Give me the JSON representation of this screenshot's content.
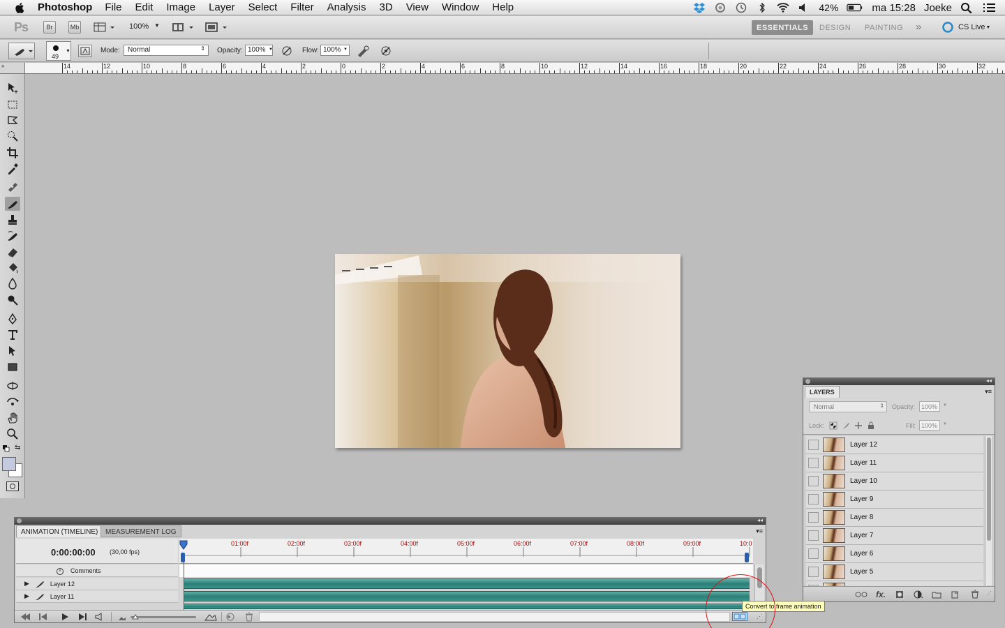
{
  "menubar": {
    "app": "Photoshop",
    "items": [
      "File",
      "Edit",
      "Image",
      "Layer",
      "Select",
      "Filter",
      "Analysis",
      "3D",
      "View",
      "Window",
      "Help"
    ],
    "battery": "42%",
    "clock": "ma 15:28",
    "user": "Joeke"
  },
  "appbar": {
    "logo": "Ps",
    "br": "Br",
    "mb": "Mb",
    "zoom": "100%",
    "workspaces": [
      "ESSENTIALS",
      "DESIGN",
      "PAINTING"
    ],
    "cslive": "CS Live"
  },
  "options": {
    "brush_size": "49",
    "mode_label": "Mode:",
    "mode_value": "Normal",
    "opacity_label": "Opacity:",
    "opacity_value": "100%",
    "flow_label": "Flow:",
    "flow_value": "100%"
  },
  "ruler": {
    "labels": [
      "14",
      "12",
      "10",
      "8",
      "6",
      "4",
      "2",
      "0",
      "2",
      "4",
      "6",
      "8",
      "10",
      "12",
      "14",
      "16",
      "18",
      "20",
      "22",
      "24",
      "26",
      "28",
      "30",
      "32"
    ]
  },
  "animation": {
    "tabs": [
      "ANIMATION (TIMELINE)",
      "MEASUREMENT LOG"
    ],
    "timecode": "0:00:00:00",
    "fps": "(30,00 fps)",
    "time_labels": [
      "01:00f",
      "02:00f",
      "03:00f",
      "04:00f",
      "05:00f",
      "06:00f",
      "07:00f",
      "08:00f",
      "09:00f",
      "10:0"
    ],
    "rows": [
      "Comments",
      "Layer 12",
      "Layer 11"
    ],
    "tooltip": "Convert to frame animation"
  },
  "layers": {
    "title": "LAYERS",
    "blend": "Normal",
    "opacity_label": "Opacity:",
    "opacity_value": "100%",
    "lock_label": "Lock:",
    "fill_label": "Fill:",
    "fill_value": "100%",
    "items": [
      "Layer 12",
      "Layer 11",
      "Layer 10",
      "Layer 9",
      "Layer 8",
      "Layer 7",
      "Layer 6",
      "Layer 5"
    ],
    "footer_fx": "fx."
  },
  "colors": {
    "timeline_bar": "#3a958c",
    "time_label": "#a01010",
    "tooltip_bg": "#fefec0"
  }
}
